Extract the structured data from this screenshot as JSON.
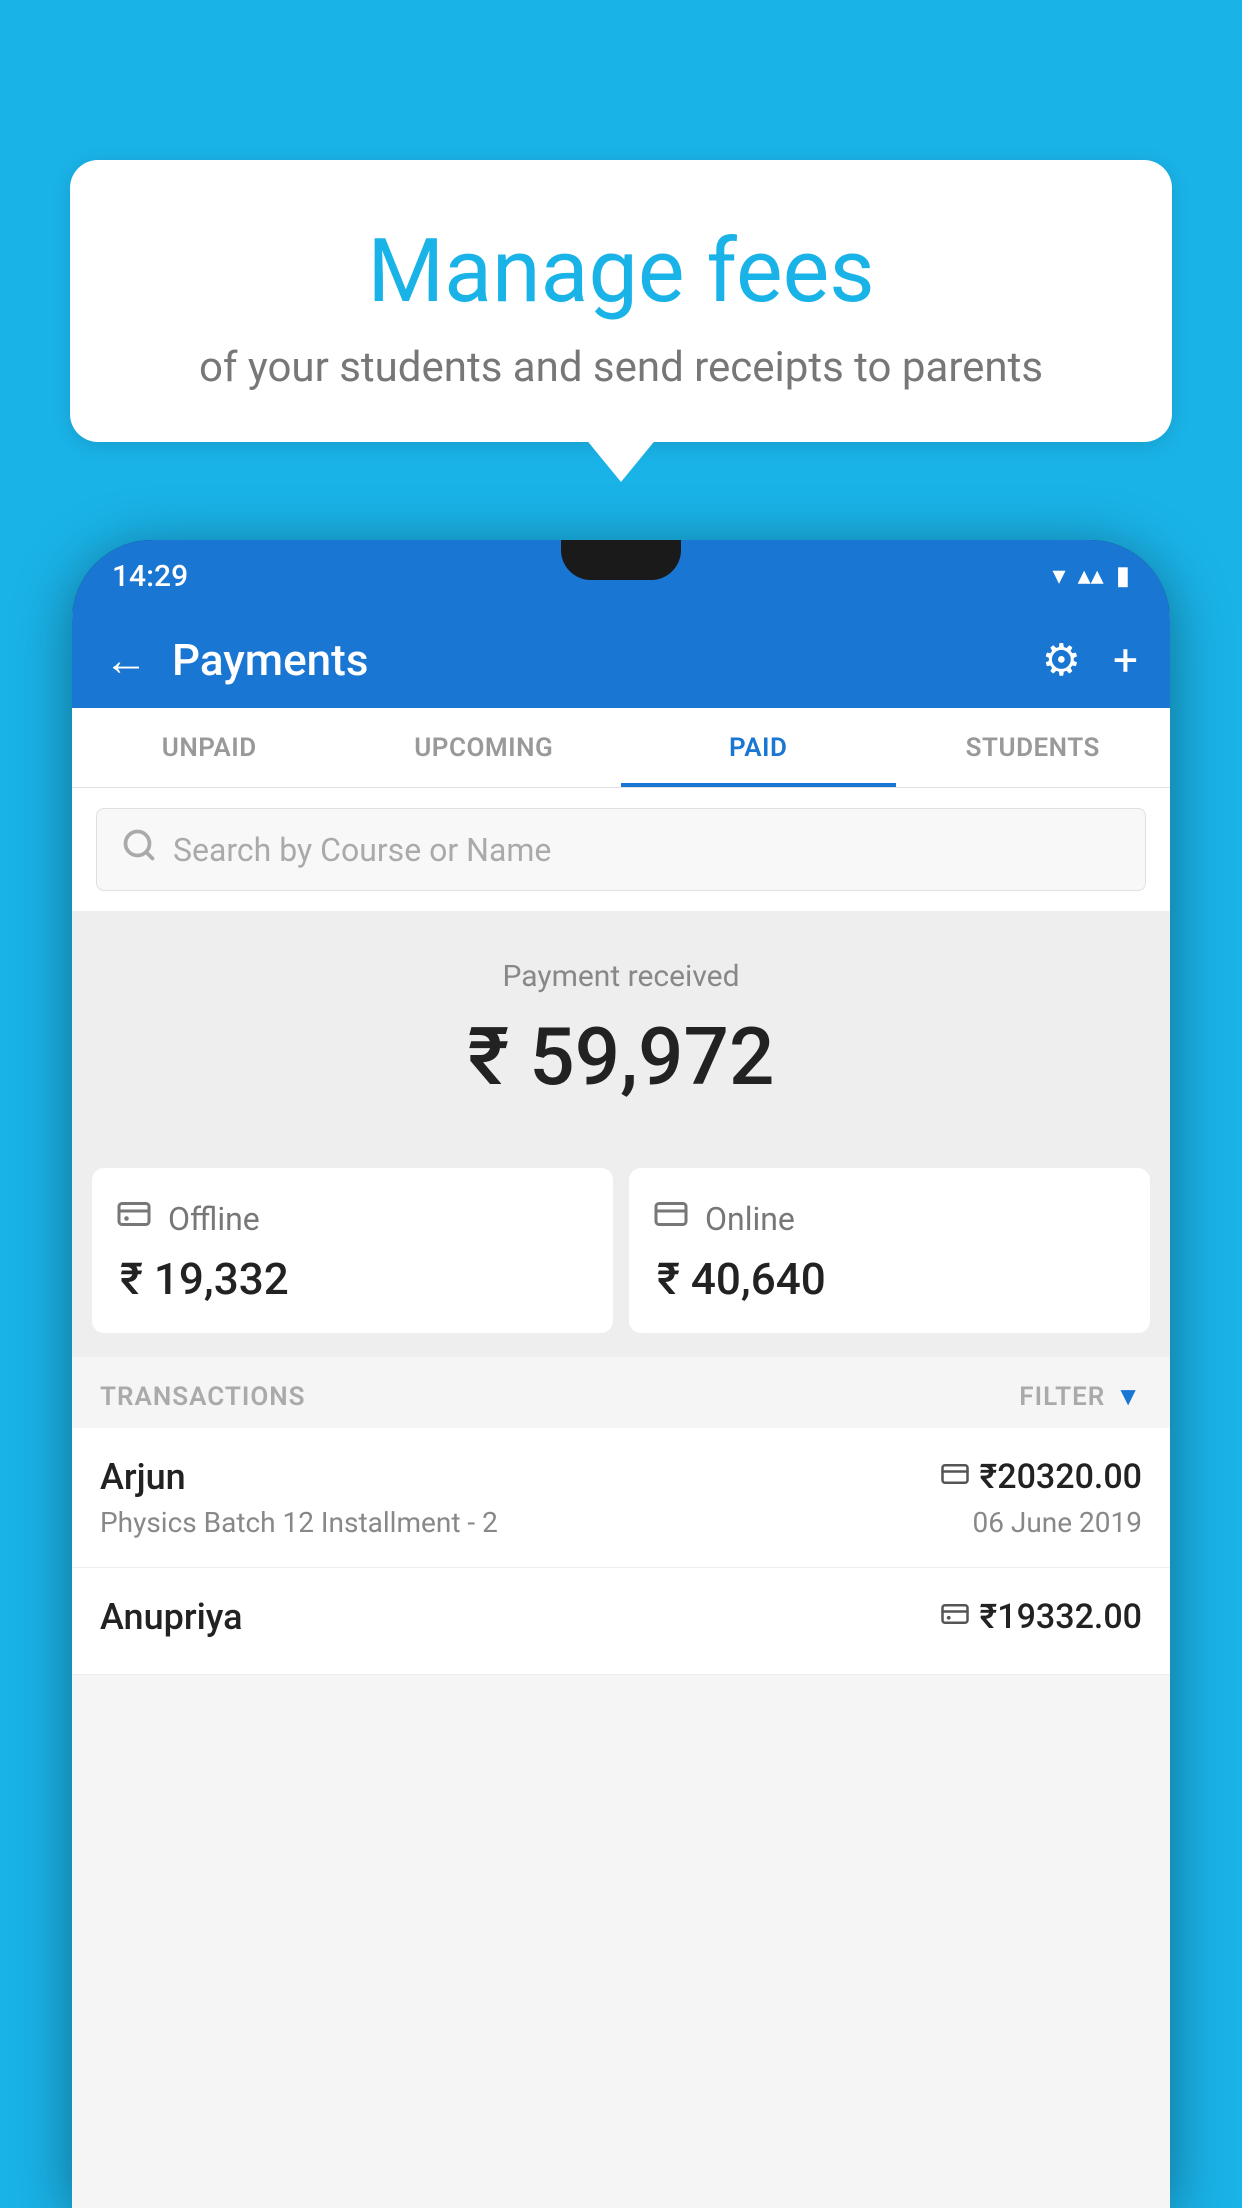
{
  "background_color": "#1ab3e8",
  "tooltip": {
    "heading": "Manage fees",
    "subtext": "of your students and send receipts to parents"
  },
  "status_bar": {
    "time": "14:29",
    "wifi_icon": "▲",
    "signal_icon": "▲",
    "battery_icon": "▮"
  },
  "header": {
    "back_label": "←",
    "title": "Payments",
    "settings_label": "⚙",
    "add_label": "+"
  },
  "tabs": [
    {
      "label": "UNPAID",
      "active": false
    },
    {
      "label": "UPCOMING",
      "active": false
    },
    {
      "label": "PAID",
      "active": true
    },
    {
      "label": "STUDENTS",
      "active": false
    }
  ],
  "search": {
    "placeholder": "Search by Course or Name"
  },
  "payment_summary": {
    "label": "Payment received",
    "amount": "₹ 59,972",
    "offline": {
      "type": "Offline",
      "amount": "₹ 19,332",
      "icon": "💳"
    },
    "online": {
      "type": "Online",
      "amount": "₹ 40,640",
      "icon": "💳"
    }
  },
  "transactions": {
    "label": "TRANSACTIONS",
    "filter_label": "FILTER",
    "rows": [
      {
        "name": "Arjun",
        "course": "Physics Batch 12 Installment - 2",
        "amount": "₹20320.00",
        "date": "06 June 2019",
        "payment_type": "online"
      },
      {
        "name": "Anupriya",
        "course": "",
        "amount": "₹19332.00",
        "date": "",
        "payment_type": "offline"
      }
    ]
  }
}
